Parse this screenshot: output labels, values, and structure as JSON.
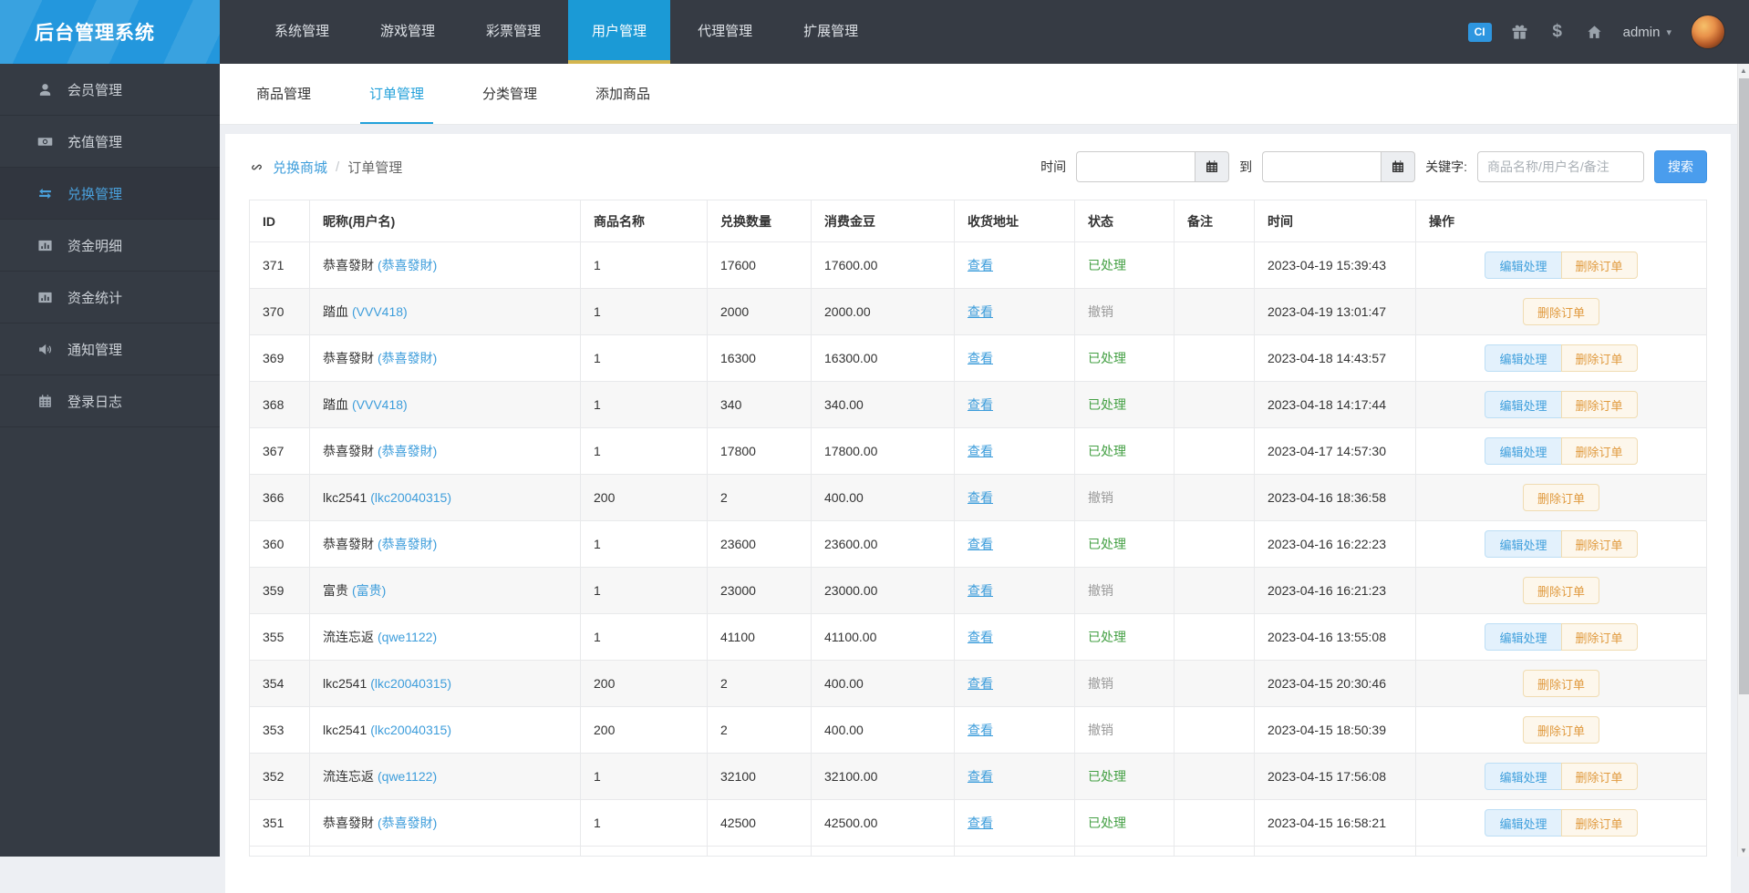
{
  "app": {
    "title": "后台管理系统"
  },
  "navbar": {
    "items": [
      {
        "label": "系统管理",
        "active": false
      },
      {
        "label": "游戏管理",
        "active": false
      },
      {
        "label": "彩票管理",
        "active": false
      },
      {
        "label": "用户管理",
        "active": true
      },
      {
        "label": "代理管理",
        "active": false
      },
      {
        "label": "扩展管理",
        "active": false
      }
    ],
    "badges": {
      "cny": "CI",
      "dollar": "$"
    },
    "user": {
      "name": "admin",
      "caret": "▾"
    }
  },
  "sidebar": {
    "items": [
      {
        "label": "会员管理",
        "icon": "user-icon",
        "active": false
      },
      {
        "label": "充值管理",
        "icon": "banknote-icon",
        "active": false
      },
      {
        "label": "兑换管理",
        "icon": "exchange-icon",
        "active": true
      },
      {
        "label": "资金明细",
        "icon": "bar-chart-icon",
        "active": false
      },
      {
        "label": "资金统计",
        "icon": "bar-chart-icon",
        "active": false
      },
      {
        "label": "通知管理",
        "icon": "speaker-icon",
        "active": false
      },
      {
        "label": "登录日志",
        "icon": "calendar-icon",
        "active": false
      }
    ]
  },
  "tabs": {
    "items": [
      {
        "label": "商品管理",
        "active": false
      },
      {
        "label": "订单管理",
        "active": true
      },
      {
        "label": "分类管理",
        "active": false
      },
      {
        "label": "添加商品",
        "active": false
      }
    ]
  },
  "breadcrumb": {
    "section": "兑换商城",
    "separator": "/",
    "current": "订单管理"
  },
  "filters": {
    "time_label": "时间",
    "to_label": "到",
    "keyword_label": "关键字:",
    "time_from": "",
    "time_to": "",
    "keyword_value": "",
    "keyword_placeholder": "商品名称/用户名/备注",
    "search_label": "搜索"
  },
  "table": {
    "columns": [
      "ID",
      "昵称(用户名)",
      "商品名称",
      "兑换数量",
      "消费金豆",
      "收货地址",
      "状态",
      "备注",
      "时间",
      "操作"
    ],
    "view_label": "查看",
    "edit_label": "编辑处理",
    "delete_label": "删除订单",
    "rows": [
      {
        "id": "371",
        "nickname": "恭喜發財",
        "username": "(恭喜發財)",
        "product": "1",
        "quantity": "17600",
        "amount": "17600.00",
        "status": "已处理",
        "status_type": "processed",
        "remark": "",
        "time": "2023-04-19 15:39:43",
        "editable": true
      },
      {
        "id": "370",
        "nickname": "踏血",
        "username": "(VVV418)",
        "product": "1",
        "quantity": "2000",
        "amount": "2000.00",
        "status": "撤销",
        "status_type": "cancelled",
        "remark": "",
        "time": "2023-04-19 13:01:47",
        "editable": false
      },
      {
        "id": "369",
        "nickname": "恭喜發財",
        "username": "(恭喜發財)",
        "product": "1",
        "quantity": "16300",
        "amount": "16300.00",
        "status": "已处理",
        "status_type": "processed",
        "remark": "",
        "time": "2023-04-18 14:43:57",
        "editable": true
      },
      {
        "id": "368",
        "nickname": "踏血",
        "username": "(VVV418)",
        "product": "1",
        "quantity": "340",
        "amount": "340.00",
        "status": "已处理",
        "status_type": "processed",
        "remark": "",
        "time": "2023-04-18 14:17:44",
        "editable": true
      },
      {
        "id": "367",
        "nickname": "恭喜發財",
        "username": "(恭喜發財)",
        "product": "1",
        "quantity": "17800",
        "amount": "17800.00",
        "status": "已处理",
        "status_type": "processed",
        "remark": "",
        "time": "2023-04-17 14:57:30",
        "editable": true
      },
      {
        "id": "366",
        "nickname": "lkc2541",
        "username": "(lkc20040315)",
        "product": "200",
        "quantity": "2",
        "amount": "400.00",
        "status": "撤销",
        "status_type": "cancelled",
        "remark": "",
        "time": "2023-04-16 18:36:58",
        "editable": false
      },
      {
        "id": "360",
        "nickname": "恭喜發財",
        "username": "(恭喜發財)",
        "product": "1",
        "quantity": "23600",
        "amount": "23600.00",
        "status": "已处理",
        "status_type": "processed",
        "remark": "",
        "time": "2023-04-16 16:22:23",
        "editable": true
      },
      {
        "id": "359",
        "nickname": "富贵",
        "username": "(富贵)",
        "product": "1",
        "quantity": "23000",
        "amount": "23000.00",
        "status": "撤销",
        "status_type": "cancelled",
        "remark": "",
        "time": "2023-04-16 16:21:23",
        "editable": false
      },
      {
        "id": "355",
        "nickname": "流连忘返",
        "username": "(qwe1122)",
        "product": "1",
        "quantity": "41100",
        "amount": "41100.00",
        "status": "已处理",
        "status_type": "processed",
        "remark": "",
        "time": "2023-04-16 13:55:08",
        "editable": true
      },
      {
        "id": "354",
        "nickname": "lkc2541",
        "username": "(lkc20040315)",
        "product": "200",
        "quantity": "2",
        "amount": "400.00",
        "status": "撤销",
        "status_type": "cancelled",
        "remark": "",
        "time": "2023-04-15 20:30:46",
        "editable": false
      },
      {
        "id": "353",
        "nickname": "lkc2541",
        "username": "(lkc20040315)",
        "product": "200",
        "quantity": "2",
        "amount": "400.00",
        "status": "撤销",
        "status_type": "cancelled",
        "remark": "",
        "time": "2023-04-15 18:50:39",
        "editable": false
      },
      {
        "id": "352",
        "nickname": "流连忘返",
        "username": "(qwe1122)",
        "product": "1",
        "quantity": "32100",
        "amount": "32100.00",
        "status": "已处理",
        "status_type": "processed",
        "remark": "",
        "time": "2023-04-15 17:56:08",
        "editable": true
      },
      {
        "id": "351",
        "nickname": "恭喜發財",
        "username": "(恭喜發財)",
        "product": "1",
        "quantity": "42500",
        "amount": "42500.00",
        "status": "已处理",
        "status_type": "processed",
        "remark": "",
        "time": "2023-04-15 16:58:21",
        "editable": true
      }
    ]
  },
  "colors": {
    "navbar_bg": "#363b44",
    "logo_blue": "#2397dd",
    "nav_active_blue": "#1b9ad6",
    "nav_active_underline": "#d4b54e",
    "accent_blue": "#22a0da",
    "link_blue": "#3d9ddb",
    "status_processed_green": "#44a044",
    "status_cancelled_gray": "#9a9a9a",
    "edit_button_orange_pair": "#3f9fdc",
    "delete_button_orange": "#e09a3e",
    "search_button_blue": "#4a9ded"
  }
}
